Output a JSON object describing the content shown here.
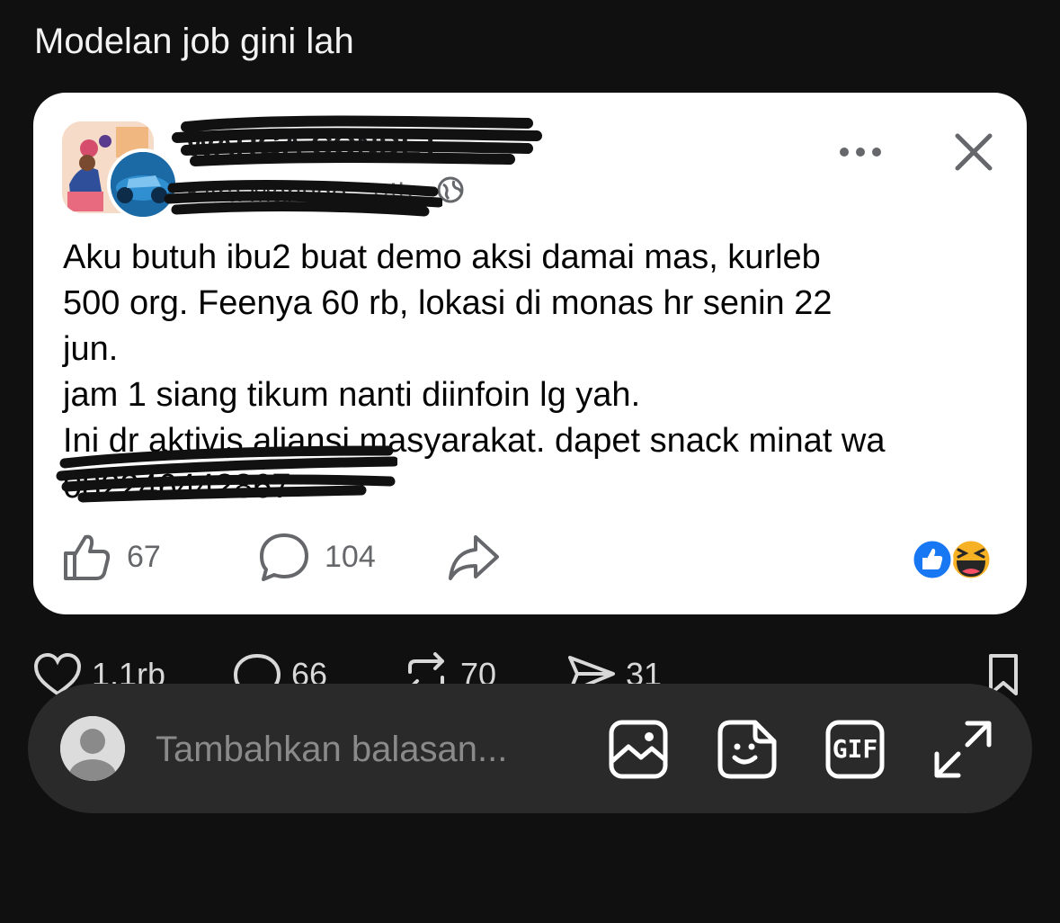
{
  "caption": "Modelan job gini lah",
  "post": {
    "group_name": "WARGA CONDET",
    "author": "Kitra Marlugo",
    "time": "14h",
    "separator": "·",
    "text": "Aku butuh ibu2 buat demo aksi damai mas, kurleb\n500 org. Feenya 60 rb, lokasi di monas hr senin 22\njun.\njam 1 siang tikum nanti diinfoin lg yah.\nIni dr aktivis aliansi masyarakat. dapet snack minat wa",
    "phone": "082246442867",
    "likes": "67",
    "comments": "104",
    "icons": {
      "more": "more-horizontal-icon",
      "close": "close-icon",
      "globe": "globe-icon",
      "like": "thumbs-up-icon",
      "comment": "comment-bubble-icon",
      "share": "share-arrow-icon",
      "reaction_like": "like-reaction-icon",
      "reaction_haha": "haha-reaction-icon"
    }
  },
  "stats": {
    "likes": "1,1rb",
    "replies": "66",
    "reposts": "70",
    "shares": "31"
  },
  "reply_bar": {
    "placeholder": "Tambahkan balasan...",
    "gif_label": "GIF"
  },
  "colors": {
    "background": "#101010",
    "card": "#ffffff",
    "facebook_blue": "#1877f2",
    "reply_bar": "#2a2a2a"
  }
}
